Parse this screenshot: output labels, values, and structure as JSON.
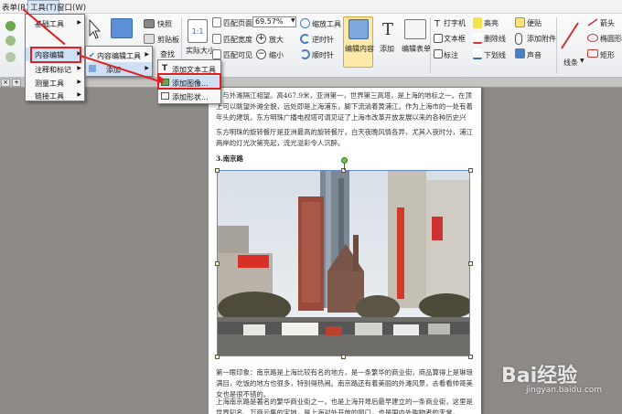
{
  "menubar": {
    "items": [
      "表单(R)",
      "工具(T)",
      "窗口(W)"
    ]
  },
  "ribbon": {
    "snapshot": "快照",
    "clipboard": "剪贴板",
    "find": "查找",
    "actual_size": "实际大小",
    "fit_page": "匹配页面",
    "zoom_value": "69.57%",
    "fit_width": "匹配宽度",
    "fit_visible": "匹配可见",
    "zoom_in": "放大",
    "zoom_out": "缩小",
    "zoom_tool": "缩放工具",
    "rotate_left": "逆时针",
    "rotate_right": "顺时针",
    "edit_content": "编辑内容",
    "add": "添加",
    "edit_form": "编辑表单",
    "typewriter": "打字机",
    "textbox": "文本框",
    "callout": "标注",
    "highlight": "高亮",
    "strikeout": "删除线",
    "underline": "下划线",
    "note": "便贴",
    "attach": "添加附件",
    "sound": "声音",
    "line": "线条",
    "arrow": "箭头",
    "ellipse": "椭圆形",
    "rect": "矩形"
  },
  "menu1": {
    "items": [
      "基础工具",
      "内容编辑",
      "注释和标记",
      "测量工具",
      "链接工具"
    ]
  },
  "menu2": {
    "items": [
      "内容编辑工具",
      "添加"
    ]
  },
  "menu3": {
    "items": [
      "添加文本工具",
      "添加图像...",
      "添加形状..."
    ]
  },
  "tab": {
    "close": "×",
    "new": "+"
  },
  "document": {
    "p1": "，与外滩隔江相望。高467.9米，亚洲第一，世界第三高塔，是上海的地标之一。在顶上可以眺望外滩全貌，远处即是上海浦东，脚下流淌着黄浦江。作为上海市的一处有着年头的建筑，东方明珠广播电视塔可谓见证了上海市改革开放发展以来的各种历史兴衰。",
    "p2": "东方明珠的旋转餐厅是亚洲最高的旋转餐厅，白天夜晚风情各异，尤其入夜时分，浦江两岸的灯光次第亮起，流光溢彩令人沉醉。",
    "heading3": "3.南京路",
    "p3": "第一眼印象：南京路是上海比较有名的地方，是一条繁华的商业街，商品算得上是琳琅满目，吃饭的地方也很多，特别得热闹。南京路还有着美丽的外滩风景，去看看帅哥美女也是很不错的。",
    "p4": "上海南京路是著名的繁华商业街之一，也是上海开埠后最早建立的一条商业街，这里是世界知名、万商云集的宝地，是上海对外开放的窗口，也是国内外购物者的天堂。"
  },
  "watermark": {
    "text": "Bai经验",
    "url": "jingyan.baidu.com"
  },
  "colors": {
    "ribbon_blue": "#4a7fc1",
    "accent_red": "#e02020",
    "menu_highlight": "#cfe0f4"
  }
}
